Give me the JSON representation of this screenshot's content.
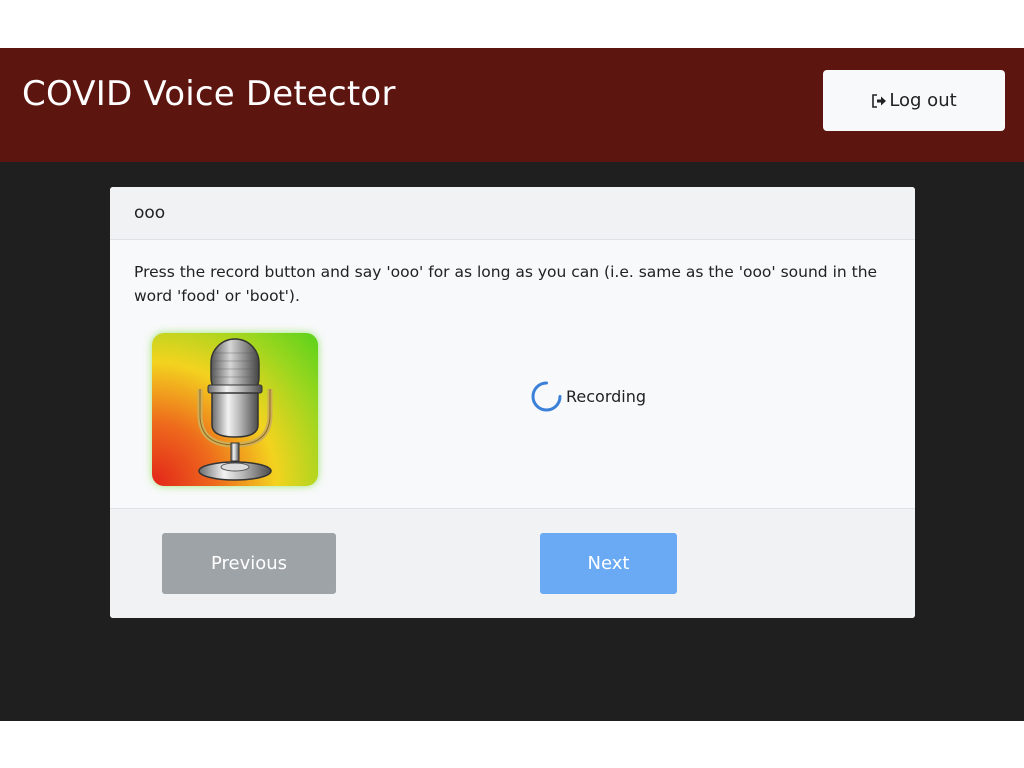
{
  "header": {
    "title": "COVID Voice Detector",
    "logout_label": "Log out"
  },
  "card": {
    "title": "ooo",
    "instructions": "Press the record button and say 'ooo' for as long as you can (i.e. same as the 'ooo' sound in the word 'food' or 'boot').",
    "status_text": "Recording"
  },
  "footer": {
    "previous_label": "Previous",
    "next_label": "Next"
  },
  "colors": {
    "topbar": "#5d1510",
    "page_background": "#1f1f1f",
    "previous_button": "#9ea3a8",
    "next_button": "#6aaaf5",
    "spinner": "#3a80d9"
  },
  "icons": {
    "logout": "sign-out-icon",
    "microphone": "microphone-icon",
    "spinner": "loading-spinner-icon"
  }
}
